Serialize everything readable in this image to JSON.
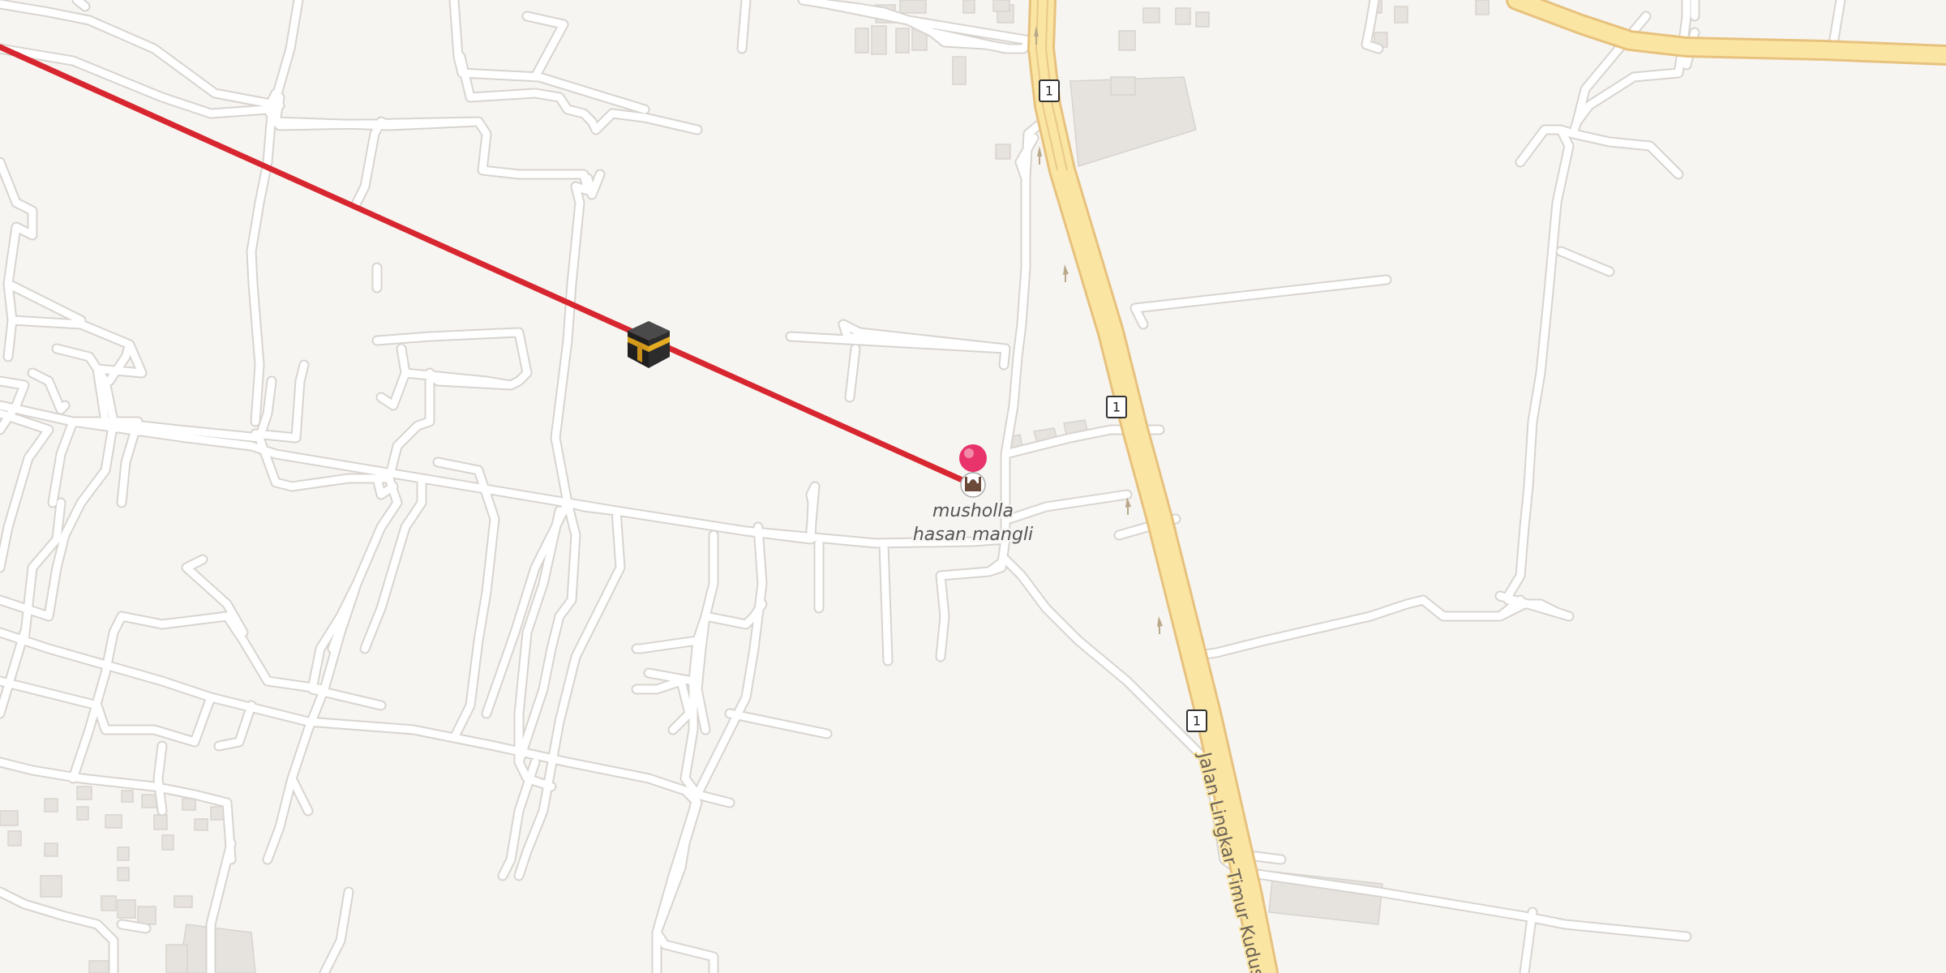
{
  "map": {
    "poi": {
      "label_line1": "musholla",
      "label_line2": "hasan mangli",
      "icon": "mosque-icon",
      "marker_color": "#e8336b"
    },
    "qibla_icon": "kaaba-icon",
    "qibla_line_color": "#d7262f",
    "highway_label": "Jalan Lingkar Timur Kudus",
    "route_shields": [
      "1",
      "1",
      "1"
    ],
    "colors": {
      "background": "#f7f5f2",
      "minor_road": "#ffffff",
      "highway_fill": "#fbe5a2",
      "highway_casing": "#e7c27e",
      "building": "#e6e2dd"
    }
  }
}
